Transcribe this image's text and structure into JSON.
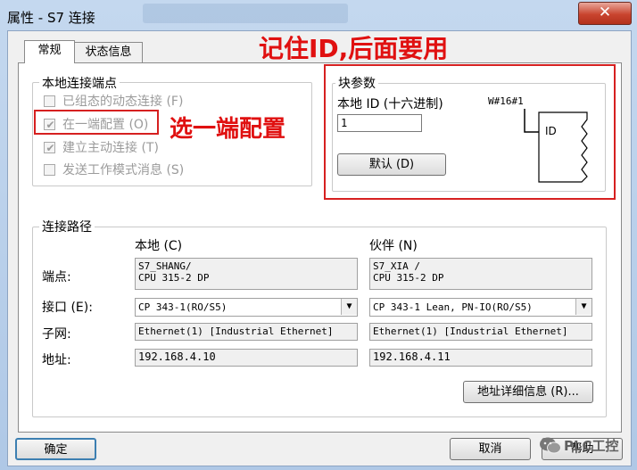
{
  "window": {
    "title": "属性 - S7 连接",
    "close_glyph": "✕"
  },
  "tabs": [
    {
      "label": "常规"
    },
    {
      "label": "状态信息"
    }
  ],
  "local_endpoint": {
    "legend": "本地连接端点",
    "options": [
      {
        "label": "已组态的动态连接 (F)",
        "checked": false
      },
      {
        "label": "在一端配置 (O)",
        "checked": true
      },
      {
        "label": "建立主动连接 (T)",
        "checked": true
      },
      {
        "label": "发送工作模式消息 (S)",
        "checked": false
      }
    ]
  },
  "annotations": {
    "one_side": "选一端配置",
    "remember_id": "记住ID,后面要用"
  },
  "block_params": {
    "legend": "块参数",
    "local_id_label": "本地 ID (十六进制)",
    "local_id_value": "1",
    "wdigit": "W#16#1",
    "block_text": "ID",
    "default_button": "默认 (D)"
  },
  "path": {
    "legend": "连接路径",
    "local_header": "本地 (C)",
    "partner_header": "伙伴 (N)",
    "row_labels": {
      "endpoint": "端点:",
      "interface": "接口 (E):",
      "subnet": "子网:",
      "address": "地址:"
    },
    "local": {
      "endpoint": "S7_SHANG/\nCPU 315-2 DP",
      "interface": "CP 343-1(RO/S5)",
      "subnet": "Ethernet(1) [Industrial Ethernet]",
      "address": "192.168.4.10"
    },
    "partner": {
      "endpoint": "S7_XIA /\nCPU 315-2 DP",
      "interface": "CP 343-1 Lean, PN-IO(RO/S5)",
      "subnet": "Ethernet(1) [Industrial Ethernet]",
      "address": "192.168.4.11"
    },
    "details_button": "地址详细信息 (R)..."
  },
  "footer": {
    "ok": "确定",
    "cancel": "取消",
    "help": "帮助"
  },
  "watermark": "PLC工控",
  "colors": {
    "annotation": "#e01010",
    "title_bar": "#b9d1ea",
    "close": "#c9452f"
  }
}
